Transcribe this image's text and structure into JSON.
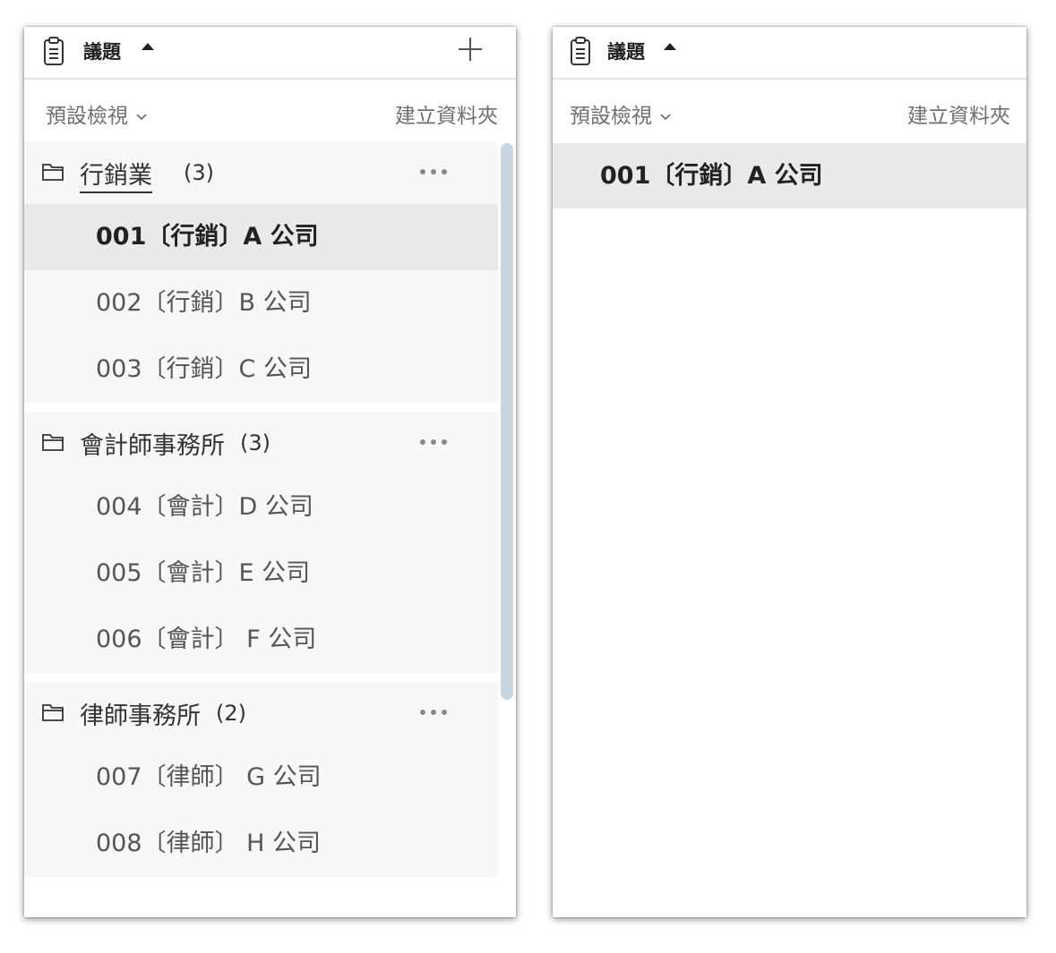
{
  "left_panel": {
    "header": {
      "title": "議題"
    },
    "subbar": {
      "view_label": "預設檢視",
      "create_folder_label": "建立資料夾"
    },
    "groups": [
      {
        "name": "行銷業",
        "count": "(3)",
        "items": [
          "001〔行銷〕A 公司",
          "002〔行銷〕B 公司",
          "003〔行銷〕C 公司"
        ]
      },
      {
        "name": "會計師事務所",
        "count": "(3)",
        "items": [
          "004〔會計〕D 公司",
          "005〔會計〕E 公司",
          "006〔會計〕 F 公司"
        ]
      },
      {
        "name": "律師事務所",
        "count": "(2)",
        "items": [
          "007〔律師〕 G 公司",
          "008〔律師〕 H 公司"
        ]
      }
    ],
    "selected_item": "001〔行銷〕A 公司"
  },
  "right_panel": {
    "header": {
      "title": "議題"
    },
    "subbar": {
      "view_label": "預設檢視",
      "create_folder_label": "建立資料夾"
    },
    "items": [
      "001〔行銷〕A 公司"
    ]
  },
  "icons": {
    "clipboard": "clipboard-icon",
    "caret": "caret-up-icon",
    "plus": "plus-icon",
    "chevron": "chevron-down-icon",
    "folder": "folder-icon",
    "more": "more-horizontal-icon"
  },
  "colors": {
    "selected_bg": "#e9e9e9",
    "group_bg": "#f7f7f7",
    "scrollbar": "#c9d6e0",
    "muted_text": "#6f6f6f"
  }
}
